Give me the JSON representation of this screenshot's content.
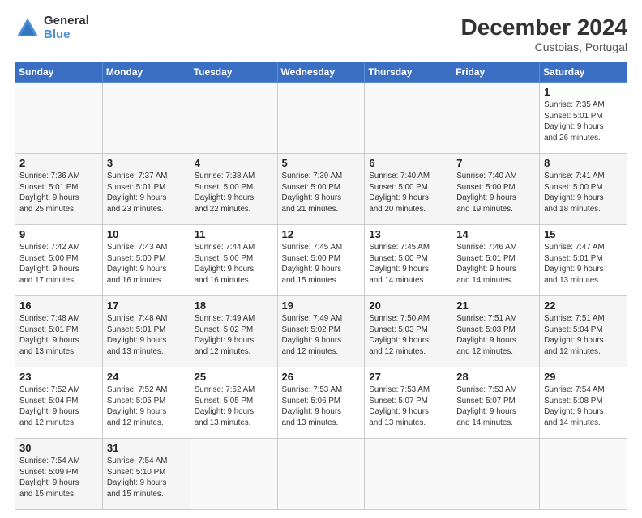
{
  "logo": {
    "general": "General",
    "blue": "Blue"
  },
  "header": {
    "month": "December 2024",
    "location": "Custoias, Portugal"
  },
  "weekdays": [
    "Sunday",
    "Monday",
    "Tuesday",
    "Wednesday",
    "Thursday",
    "Friday",
    "Saturday"
  ],
  "days": [
    {
      "num": "",
      "info": ""
    },
    {
      "num": "",
      "info": ""
    },
    {
      "num": "",
      "info": ""
    },
    {
      "num": "",
      "info": ""
    },
    {
      "num": "",
      "info": ""
    },
    {
      "num": "",
      "info": ""
    },
    {
      "num": "1",
      "info": "Sunrise: 7:35 AM\nSunset: 5:01 PM\nDaylight: 9 hours\nand 26 minutes."
    },
    {
      "num": "2",
      "info": "Sunrise: 7:36 AM\nSunset: 5:01 PM\nDaylight: 9 hours\nand 25 minutes."
    },
    {
      "num": "3",
      "info": "Sunrise: 7:37 AM\nSunset: 5:01 PM\nDaylight: 9 hours\nand 23 minutes."
    },
    {
      "num": "4",
      "info": "Sunrise: 7:38 AM\nSunset: 5:00 PM\nDaylight: 9 hours\nand 22 minutes."
    },
    {
      "num": "5",
      "info": "Sunrise: 7:39 AM\nSunset: 5:00 PM\nDaylight: 9 hours\nand 21 minutes."
    },
    {
      "num": "6",
      "info": "Sunrise: 7:40 AM\nSunset: 5:00 PM\nDaylight: 9 hours\nand 20 minutes."
    },
    {
      "num": "7",
      "info": "Sunrise: 7:40 AM\nSunset: 5:00 PM\nDaylight: 9 hours\nand 19 minutes."
    },
    {
      "num": "8",
      "info": "Sunrise: 7:41 AM\nSunset: 5:00 PM\nDaylight: 9 hours\nand 18 minutes."
    },
    {
      "num": "9",
      "info": "Sunrise: 7:42 AM\nSunset: 5:00 PM\nDaylight: 9 hours\nand 17 minutes."
    },
    {
      "num": "10",
      "info": "Sunrise: 7:43 AM\nSunset: 5:00 PM\nDaylight: 9 hours\nand 16 minutes."
    },
    {
      "num": "11",
      "info": "Sunrise: 7:44 AM\nSunset: 5:00 PM\nDaylight: 9 hours\nand 16 minutes."
    },
    {
      "num": "12",
      "info": "Sunrise: 7:45 AM\nSunset: 5:00 PM\nDaylight: 9 hours\nand 15 minutes."
    },
    {
      "num": "13",
      "info": "Sunrise: 7:45 AM\nSunset: 5:00 PM\nDaylight: 9 hours\nand 14 minutes."
    },
    {
      "num": "14",
      "info": "Sunrise: 7:46 AM\nSunset: 5:01 PM\nDaylight: 9 hours\nand 14 minutes."
    },
    {
      "num": "15",
      "info": "Sunrise: 7:47 AM\nSunset: 5:01 PM\nDaylight: 9 hours\nand 13 minutes."
    },
    {
      "num": "16",
      "info": "Sunrise: 7:48 AM\nSunset: 5:01 PM\nDaylight: 9 hours\nand 13 minutes."
    },
    {
      "num": "17",
      "info": "Sunrise: 7:48 AM\nSunset: 5:01 PM\nDaylight: 9 hours\nand 13 minutes."
    },
    {
      "num": "18",
      "info": "Sunrise: 7:49 AM\nSunset: 5:02 PM\nDaylight: 9 hours\nand 12 minutes."
    },
    {
      "num": "19",
      "info": "Sunrise: 7:49 AM\nSunset: 5:02 PM\nDaylight: 9 hours\nand 12 minutes."
    },
    {
      "num": "20",
      "info": "Sunrise: 7:50 AM\nSunset: 5:03 PM\nDaylight: 9 hours\nand 12 minutes."
    },
    {
      "num": "21",
      "info": "Sunrise: 7:51 AM\nSunset: 5:03 PM\nDaylight: 9 hours\nand 12 minutes."
    },
    {
      "num": "22",
      "info": "Sunrise: 7:51 AM\nSunset: 5:04 PM\nDaylight: 9 hours\nand 12 minutes."
    },
    {
      "num": "23",
      "info": "Sunrise: 7:52 AM\nSunset: 5:04 PM\nDaylight: 9 hours\nand 12 minutes."
    },
    {
      "num": "24",
      "info": "Sunrise: 7:52 AM\nSunset: 5:05 PM\nDaylight: 9 hours\nand 12 minutes."
    },
    {
      "num": "25",
      "info": "Sunrise: 7:52 AM\nSunset: 5:05 PM\nDaylight: 9 hours\nand 13 minutes."
    },
    {
      "num": "26",
      "info": "Sunrise: 7:53 AM\nSunset: 5:06 PM\nDaylight: 9 hours\nand 13 minutes."
    },
    {
      "num": "27",
      "info": "Sunrise: 7:53 AM\nSunset: 5:07 PM\nDaylight: 9 hours\nand 13 minutes."
    },
    {
      "num": "28",
      "info": "Sunrise: 7:53 AM\nSunset: 5:07 PM\nDaylight: 9 hours\nand 14 minutes."
    },
    {
      "num": "29",
      "info": "Sunrise: 7:54 AM\nSunset: 5:08 PM\nDaylight: 9 hours\nand 14 minutes."
    },
    {
      "num": "30",
      "info": "Sunrise: 7:54 AM\nSunset: 5:09 PM\nDaylight: 9 hours\nand 15 minutes."
    },
    {
      "num": "31",
      "info": "Sunrise: 7:54 AM\nSunset: 5:10 PM\nDaylight: 9 hours\nand 15 minutes."
    },
    {
      "num": "",
      "info": ""
    },
    {
      "num": "",
      "info": ""
    },
    {
      "num": "",
      "info": ""
    },
    {
      "num": "",
      "info": ""
    },
    {
      "num": "",
      "info": ""
    }
  ]
}
